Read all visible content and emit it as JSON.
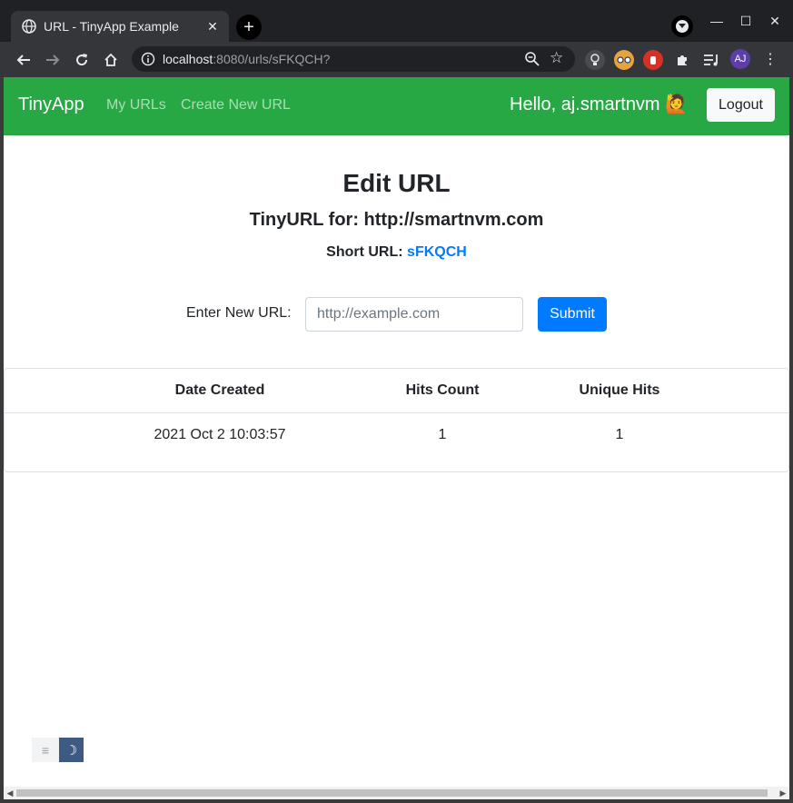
{
  "browser": {
    "tab_title": "URL - TinyApp Example",
    "tab_close": "✕",
    "new_tab": "+",
    "url_host": "localhost",
    "url_path": ":8080/urls/sFKQCH?",
    "profile_initials": "AJ",
    "window_controls": {
      "minimize": "—",
      "maximize": "☐",
      "close": "✕"
    }
  },
  "navbar": {
    "brand": "TinyApp",
    "links": [
      "My URLs",
      "Create New URL"
    ],
    "greeting": "Hello, aj.smartnvm 🙋",
    "logout_label": "Logout",
    "color": "#28a745"
  },
  "main": {
    "title": "Edit URL",
    "tiny_for": "TinyURL for: http://smartnvm.com",
    "short_label": "Short URL:",
    "short_code": "sFKQCH",
    "form": {
      "label": "Enter New URL:",
      "placeholder": "http://example.com",
      "value": "",
      "submit_label": "Submit"
    },
    "stats_table": {
      "headers": [
        "Date Created",
        "Hits Count",
        "Unique Hits"
      ],
      "rows": [
        [
          "2021 Oct 2 10:03:57",
          "1",
          "1"
        ]
      ]
    }
  },
  "theme_toggle": {
    "light_icon": "≡",
    "dark_icon": "☽"
  },
  "colors": {
    "primary": "#007bff",
    "success": "#28a745"
  }
}
